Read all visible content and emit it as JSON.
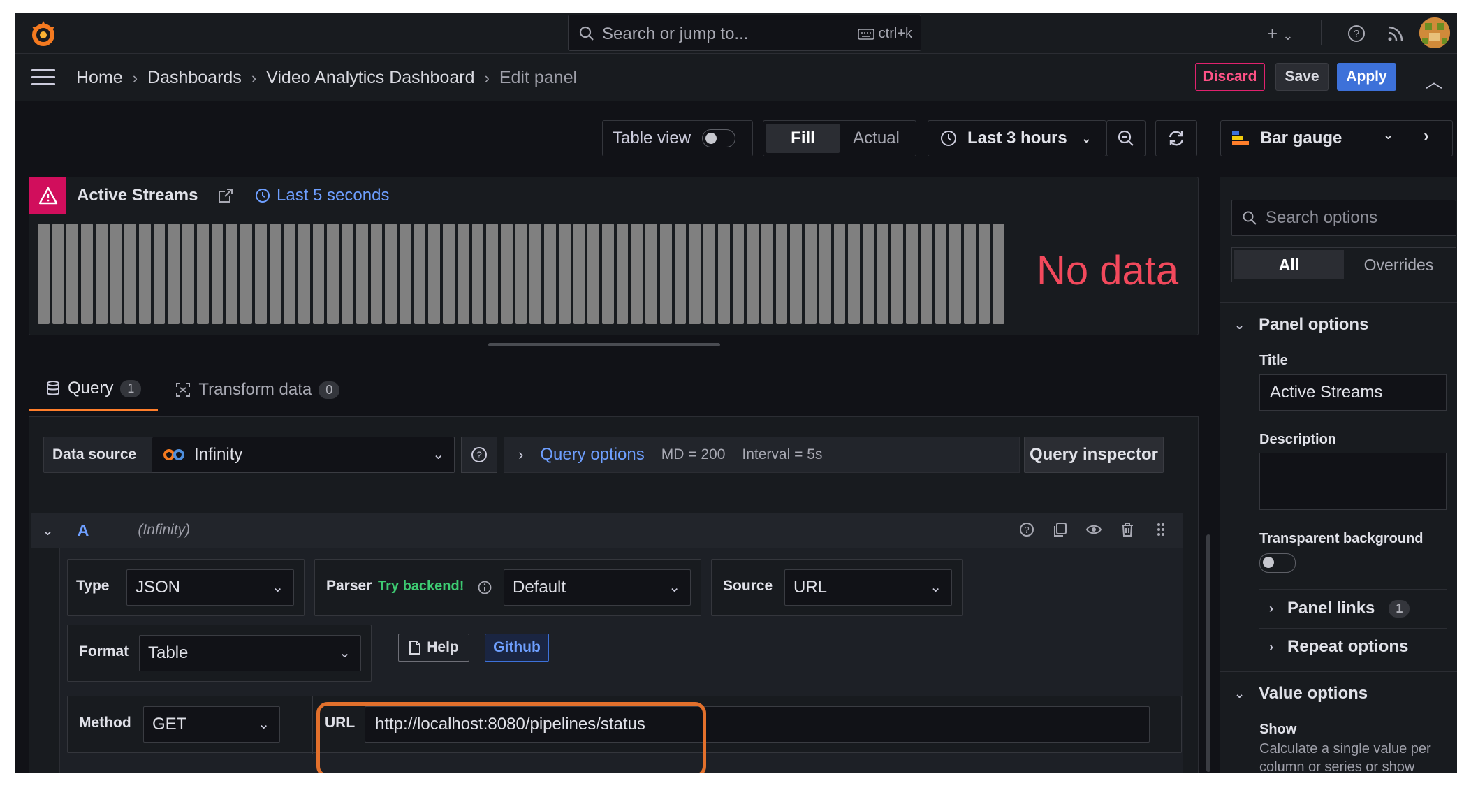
{
  "topbar": {
    "search_placeholder": "Search or jump to...",
    "search_shortcut": "ctrl+k"
  },
  "breadcrumb": {
    "items": [
      "Home",
      "Dashboards",
      "Video Analytics Dashboard",
      "Edit panel"
    ]
  },
  "actions": {
    "discard": "Discard",
    "save": "Save",
    "apply": "Apply"
  },
  "toolbar": {
    "table_view": "Table view",
    "fill": "Fill",
    "actual": "Actual",
    "time_range": "Last 3 hours",
    "visualization": "Bar gauge"
  },
  "preview": {
    "title": "Active Streams",
    "time_override": "Last 5 seconds",
    "no_data": "No data",
    "bar_count": 67,
    "bar_color": "#808080"
  },
  "tabs": [
    {
      "label": "Query",
      "count": "1"
    },
    {
      "label": "Transform data",
      "count": "0"
    }
  ],
  "query_editor": {
    "data_source_label": "Data source",
    "data_source": "Infinity",
    "query_options_label": "Query options",
    "md": "MD = 200",
    "interval": "Interval = 5s",
    "query_inspector": "Query inspector",
    "ref_id": "A",
    "ds_name": "(Infinity)",
    "type_label": "Type",
    "type_value": "JSON",
    "parser_label": "Parser",
    "parser_hint": "Try backend!",
    "parser_value": "Default",
    "source_label": "Source",
    "source_value": "URL",
    "format_label": "Format",
    "format_value": "Table",
    "help_button": "Help",
    "github_button": "Github",
    "method_label": "Method",
    "method_value": "GET",
    "url_label": "URL",
    "url_value": "http://localhost:8080/pipelines/status"
  },
  "options": {
    "search_placeholder": "Search options",
    "tab_all": "All",
    "tab_overrides": "Overrides",
    "panel_options": "Panel options",
    "title_label": "Title",
    "title_value": "Active Streams",
    "description_label": "Description",
    "transparent_label": "Transparent background",
    "panel_links": "Panel links",
    "panel_links_count": "1",
    "repeat_options": "Repeat options",
    "value_options": "Value options",
    "show_label": "Show",
    "show_desc": "Calculate a single value per column or series or show each row"
  },
  "colors": {
    "accent_orange": "#ff7e2b",
    "highlight": "#e2702c",
    "apply_blue": "#3d71d9",
    "discard_red": "#e0226e",
    "no_data_red": "#f2495c",
    "link_blue": "#6e9fff",
    "try_green": "#3dcb72"
  }
}
